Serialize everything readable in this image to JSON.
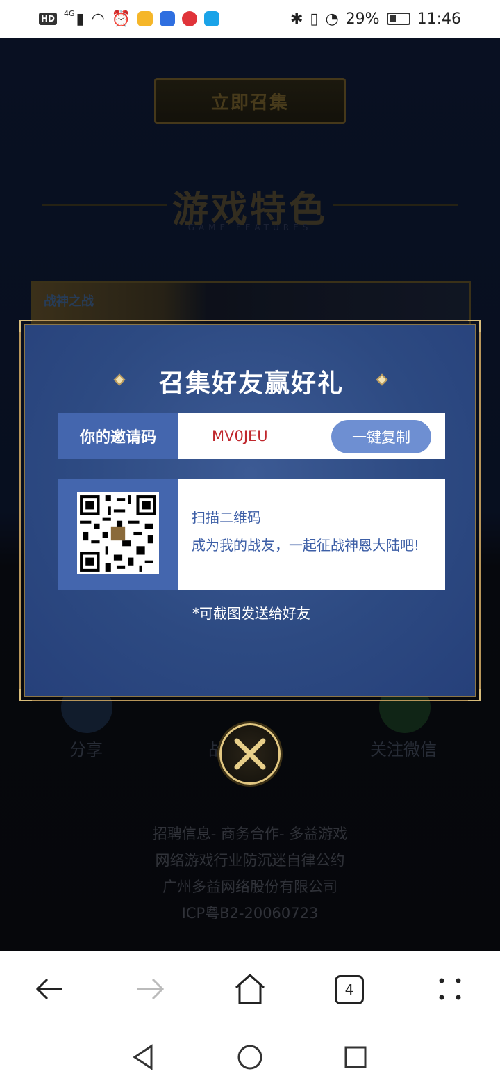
{
  "status_bar": {
    "hd_badge": "HD",
    "network": "4G",
    "battery": "29%",
    "time": "11:46"
  },
  "page": {
    "rally_button": "立即召集",
    "features_title": "游戏特色",
    "features_subtitle": "GAME FEATURES",
    "game_logo": "战神之战",
    "footer_actions": [
      "分享",
      "战盟下载",
      "关注微信"
    ],
    "footer_lines": [
      "招聘信息- 商务合作- 多益游戏",
      "网络游戏行业防沉迷自律公约",
      "广州多益网络股份有限公司",
      "ICP粤B2-20060723"
    ]
  },
  "modal": {
    "title": "召集好友赢好礼",
    "code_label": "你的邀请码",
    "code_value": "MV0JEU",
    "copy_button": "一键复制",
    "qr_line1": "扫描二维码",
    "qr_line2": "成为我的战友，一起征战神恩大陆吧!",
    "hint": "*可截图发送给好友"
  },
  "browser": {
    "tabs_count": "4",
    "icons": [
      "back-arrow-icon",
      "forward-arrow-icon",
      "home-icon",
      "tabs-icon",
      "menu-icon"
    ]
  },
  "system_nav": {
    "icons": [
      "back-triangle-icon",
      "home-circle-icon",
      "recents-square-icon"
    ]
  },
  "colors": {
    "modal_bg": "#2d4a82",
    "label_bg": "#4466ae",
    "copy_btn": "#6e8fd2",
    "code_red": "#c0282d",
    "gold": "#e2c781"
  }
}
